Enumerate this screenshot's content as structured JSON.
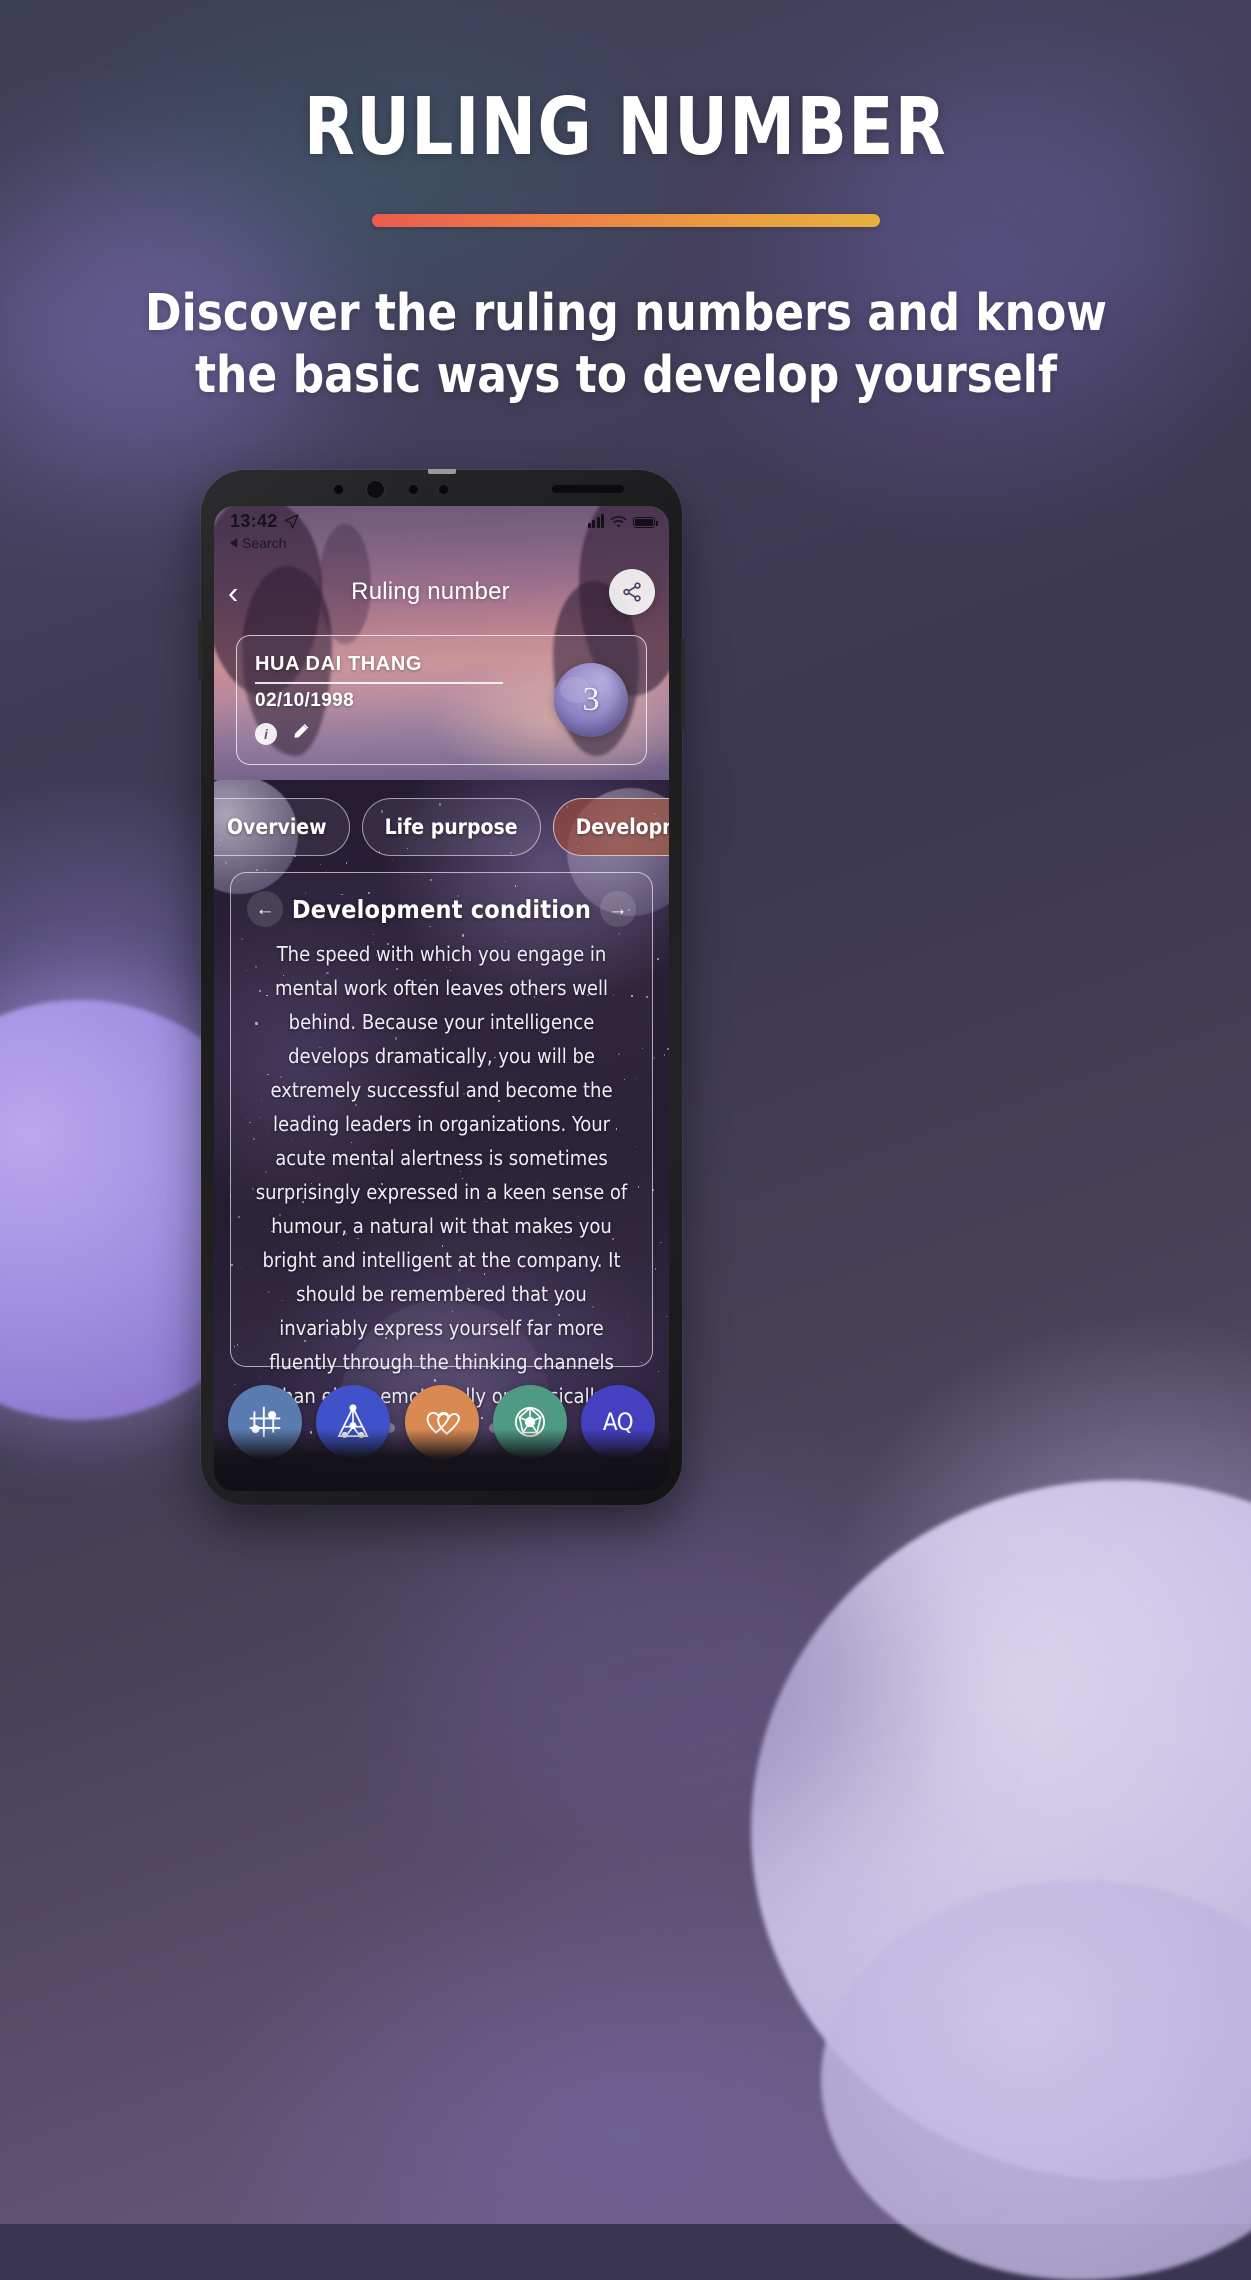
{
  "header": {
    "title": "RULING NUMBER",
    "subtitle": "Discover the ruling numbers and know the basic ways to develop yourself",
    "divider_colors": [
      "#ea5b4e",
      "#e6b03c"
    ]
  },
  "phone": {
    "status_bar": {
      "time": "13:42",
      "location_icon": "navigation-arrow-icon",
      "back_label": "Search",
      "signal_icon": "cellular-signal-icon",
      "wifi_icon": "wifi-icon",
      "battery_icon": "battery-icon"
    },
    "app_bar": {
      "back_icon": "chevron-left-icon",
      "title": "Ruling number",
      "share_icon": "share-icon"
    },
    "profile_card": {
      "name": "HUA DAI THANG",
      "date_of_birth": "02/10/1998",
      "info_icon": "info-icon",
      "edit_icon": "pencil-edit-icon",
      "ruling_number": "3"
    },
    "tabs": [
      {
        "label": "Overview",
        "active": false
      },
      {
        "label": "Life purpose",
        "active": false
      },
      {
        "label": "Development condition",
        "active": true
      }
    ],
    "content_card": {
      "prev_icon": "arrow-left-icon",
      "title": "Development condition",
      "next_icon": "arrow-right-icon",
      "body": "The speed with which you engage in mental work often leaves others well behind. Because your intelligence develops dramatically, you will be extremely successful and become the leading leaders in organizations. Your acute mental alertness is sometimes surprisingly expressed in a keen sense of humour, a natural wit that makes you bright and intelligent at the company. It should be remembered that you invariably express yourself far more fluently through the thinking channels than either emotionally or physically.",
      "pagination": {
        "total": 7,
        "active_index": 2
      }
    },
    "bottom_nav": [
      {
        "name": "birth-chart-icon",
        "color": "#5a7bb0"
      },
      {
        "name": "pyramid-chart-icon",
        "color": "#3f52c9"
      },
      {
        "name": "hearts-icon",
        "color": "#d98a52"
      },
      {
        "name": "wheel-chart-icon",
        "color": "#4e9a82"
      },
      {
        "name": "aq-label-icon",
        "color": "#4540bf",
        "label": "AQ"
      }
    ]
  }
}
